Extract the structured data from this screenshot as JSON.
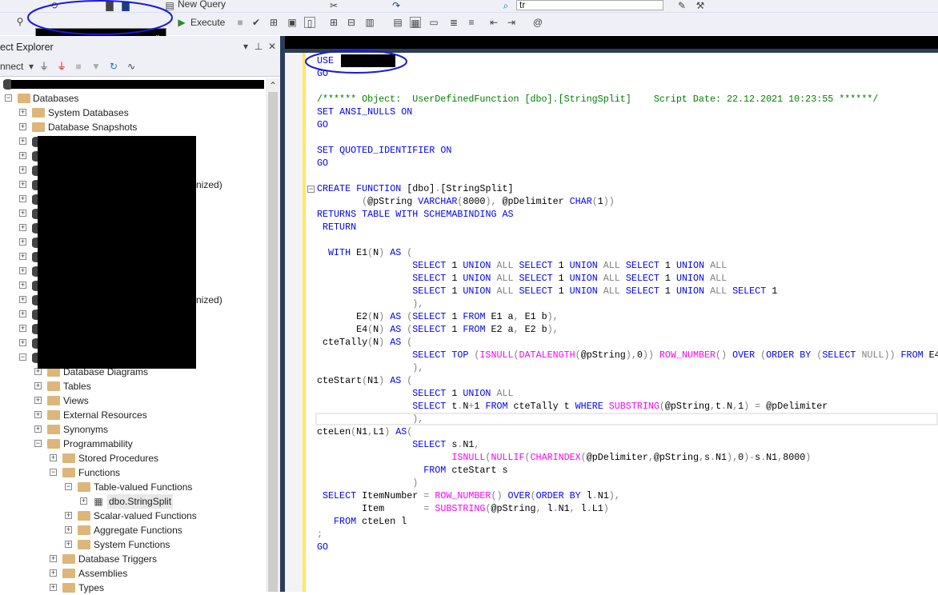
{
  "toolbar": {
    "new_query": "New Query",
    "execute": "Execute",
    "search_value": "tr",
    "database_selected": "[redacted]"
  },
  "object_explorer": {
    "title": "ect Explorer",
    "connect": "nnect",
    "tree": [
      {
        "label": "Databases",
        "level": 1,
        "state": "expanded",
        "icon": "folder"
      },
      {
        "label": "System Databases",
        "level": 2,
        "state": "collapsed",
        "icon": "folder"
      },
      {
        "label": "Database Snapshots",
        "level": 2,
        "state": "collapsed",
        "icon": "folder"
      },
      {
        "label": "Database Diagrams",
        "level": 3,
        "state": "collapsed",
        "icon": "folder"
      },
      {
        "label": "Tables",
        "level": 3,
        "state": "collapsed",
        "icon": "folder"
      },
      {
        "label": "Views",
        "level": 3,
        "state": "collapsed",
        "icon": "folder"
      },
      {
        "label": "External Resources",
        "level": 3,
        "state": "collapsed",
        "icon": "folder"
      },
      {
        "label": "Synonyms",
        "level": 3,
        "state": "collapsed",
        "icon": "folder"
      },
      {
        "label": "Programmability",
        "level": 3,
        "state": "expanded",
        "icon": "folder"
      },
      {
        "label": "Stored Procedures",
        "level": 4,
        "state": "collapsed",
        "icon": "folder"
      },
      {
        "label": "Functions",
        "level": 4,
        "state": "expanded",
        "icon": "folder"
      },
      {
        "label": "Table-valued Functions",
        "level": 5,
        "state": "expanded",
        "icon": "folder"
      },
      {
        "label": "dbo.StringSplit",
        "level": 6,
        "state": "collapsed",
        "icon": "table-function",
        "selected": true
      },
      {
        "label": "Scalar-valued Functions",
        "level": 5,
        "state": "collapsed",
        "icon": "folder"
      },
      {
        "label": "Aggregate Functions",
        "level": 5,
        "state": "collapsed",
        "icon": "folder"
      },
      {
        "label": "System Functions",
        "level": 5,
        "state": "collapsed",
        "icon": "folder"
      },
      {
        "label": "Database Triggers",
        "level": 4,
        "state": "collapsed",
        "icon": "folder"
      },
      {
        "label": "Assemblies",
        "level": 4,
        "state": "collapsed",
        "icon": "folder"
      },
      {
        "label": "Types",
        "level": 4,
        "state": "collapsed",
        "icon": "folder"
      }
    ],
    "partial_labels": [
      "nized)",
      "nized)"
    ]
  },
  "editor": {
    "code": [
      "USE",
      "GO",
      "",
      "/****** Object:  UserDefinedFunction [dbo].[StringSplit]    Script Date: 22.12.2021 10:23:55 ******/",
      "SET ANSI_NULLS ON",
      "GO",
      "",
      "SET QUOTED_IDENTIFIER ON",
      "GO",
      "",
      "CREATE FUNCTION [dbo].[StringSplit]",
      "        (@pString VARCHAR(8000), @pDelimiter CHAR(1))",
      "RETURNS TABLE WITH SCHEMABINDING AS",
      " RETURN",
      "",
      "  WITH E1(N) AS (",
      "                 SELECT 1 UNION ALL SELECT 1 UNION ALL SELECT 1 UNION ALL",
      "                 SELECT 1 UNION ALL SELECT 1 UNION ALL SELECT 1 UNION ALL",
      "                 SELECT 1 UNION ALL SELECT 1 UNION ALL SELECT 1 UNION ALL SELECT 1",
      "                 ),",
      "       E2(N) AS (SELECT 1 FROM E1 a, E1 b),",
      "       E4(N) AS (SELECT 1 FROM E2 a, E2 b),",
      " cteTally(N) AS (",
      "                 SELECT TOP (ISNULL(DATALENGTH(@pString),0)) ROW_NUMBER() OVER (ORDER BY (SELECT NULL)) FROM E4",
      "                 ),",
      "cteStart(N1) AS (",
      "                 SELECT 1 UNION ALL",
      "                 SELECT t.N+1 FROM cteTally t WHERE SUBSTRING(@pString,t.N,1) = @pDelimiter",
      "                 ),",
      "cteLen(N1,L1) AS(",
      "                 SELECT s.N1,",
      "                        ISNULL(NULLIF(CHARINDEX(@pDelimiter,@pString,s.N1),0)-s.N1,8000)",
      "                   FROM cteStart s",
      "                 )",
      " SELECT ItemNumber = ROW_NUMBER() OVER(ORDER BY l.N1),",
      "        Item       = SUBSTRING(@pString, l.N1, l.L1)",
      "   FROM cteLen l",
      ";",
      "GO"
    ]
  },
  "colors": {
    "keyword": "#0000ff",
    "function": "#ff00ff",
    "operator": "#808080",
    "comment": "#008000",
    "annotation": "#1a1adc",
    "margin": "#fde765"
  }
}
